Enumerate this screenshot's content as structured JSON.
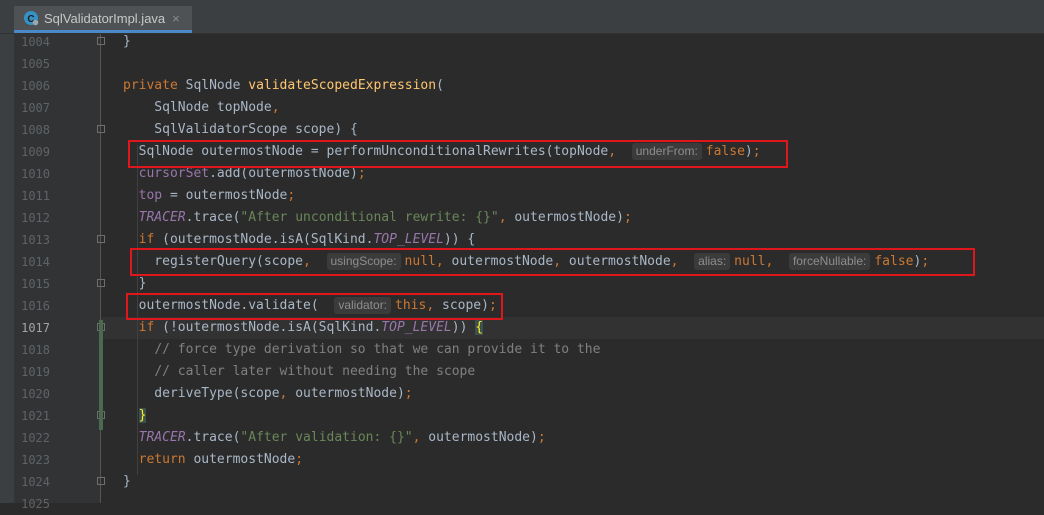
{
  "tab": {
    "label": "SqlValidatorImpl.java",
    "close": "×",
    "icon": "java-class-icon"
  },
  "lines": [
    {
      "n": "1004",
      "html": "<span>}</span>"
    },
    {
      "n": "1005",
      "html": ""
    },
    {
      "n": "1006",
      "html": "<span class=\"kw\">private</span> SqlNode <span class=\"fn\">validateScopedExpression</span>("
    },
    {
      "n": "1007",
      "html": "    SqlNode topNode<span class=\"kw\">,</span>"
    },
    {
      "n": "1008",
      "html": "    SqlValidatorScope scope) {"
    },
    {
      "n": "1009",
      "html": "  SqlNode outermostNode = performUnconditionalRewrites(topNode<span class=\"kw\">,</span>  <span class=\"hint\">underFrom:</span><span class=\"kw\">false</span>)<span class=\"kw\">;</span>"
    },
    {
      "n": "1010",
      "html": "  <span class=\"field\">cursorSet</span>.add(outermostNode)<span class=\"kw\">;</span>"
    },
    {
      "n": "1011",
      "html": "  <span class=\"field\">top</span> = outermostNode<span class=\"kw\">;</span>"
    },
    {
      "n": "1012",
      "html": "  <span class=\"tracer\">TRACER</span>.trace(<span class=\"str\">\"After unconditional rewrite: {}\"</span><span class=\"kw\">,</span> outermostNode)<span class=\"kw\">;</span>"
    },
    {
      "n": "1013",
      "html": "  <span class=\"kw\">if</span> (outermostNode.isA(SqlKind.<span class=\"konst\">TOP_LEVEL</span>)) {"
    },
    {
      "n": "1014",
      "html": "    registerQuery(scope<span class=\"kw\">,</span>  <span class=\"hint\">usingScope:</span><span class=\"kw\">null,</span> outermostNode<span class=\"kw\">,</span> outermostNode<span class=\"kw\">,</span>  <span class=\"hint\">alias:</span><span class=\"kw\">null,</span>  <span class=\"hint\">forceNullable:</span><span class=\"kw\">false</span>)<span class=\"kw\">;</span>"
    },
    {
      "n": "1015",
      "html": "  }"
    },
    {
      "n": "1016",
      "html": "  outermostNode.validate(  <span class=\"hint\">validator:</span><span class=\"kw\">this,</span> scope)<span class=\"kw\">;</span>"
    },
    {
      "n": "1017",
      "html": "  <span class=\"kw\">if</span> (!outermostNode.isA(SqlKind.<span class=\"konst\">TOP_LEVEL</span>)) <span class=\"brace-match\">{</span>"
    },
    {
      "n": "1018",
      "html": "    <span class=\"cmt\">// force type derivation so that we can provide it to the</span>"
    },
    {
      "n": "1019",
      "html": "    <span class=\"cmt\">// caller later without needing the scope</span>"
    },
    {
      "n": "1020",
      "html": "    deriveType(scope<span class=\"kw\">,</span> outermostNode)<span class=\"kw\">;</span>"
    },
    {
      "n": "1021",
      "html": "  <span class=\"brace-match\">}</span>"
    },
    {
      "n": "1022",
      "html": "  <span class=\"tracer\">TRACER</span>.trace(<span class=\"str\">\"After validation: {}\"</span><span class=\"kw\">,</span> outermostNode)<span class=\"kw\">;</span>"
    },
    {
      "n": "1023",
      "html": "  <span class=\"kw\">return</span> outermostNode<span class=\"kw\">;</span>"
    },
    {
      "n": "1024",
      "html": "}"
    },
    {
      "n": "1025",
      "html": ""
    }
  ],
  "current_line": "1017",
  "colors": {
    "keyword": "#cc7832",
    "function": "#ffc66d",
    "string": "#6a8759",
    "comment": "#808080",
    "highlight_box": "#e0161d"
  }
}
